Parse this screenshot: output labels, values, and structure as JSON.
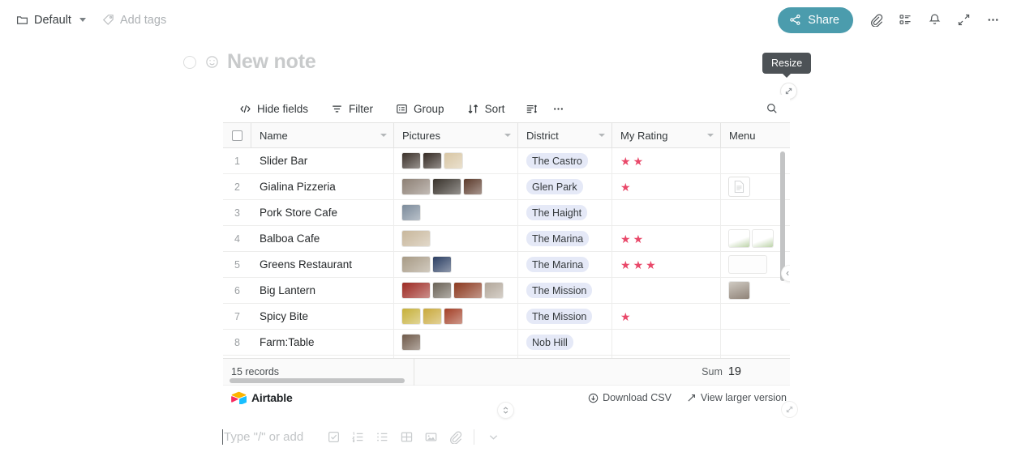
{
  "topbar": {
    "notebook_label": "Default",
    "notebook_icon": "folder-icon",
    "tags_label": "Add tags",
    "tags_icon": "tag-icon",
    "share_label": "Share",
    "share_icon": "share-nodes-icon",
    "share_color": "#4b9cad",
    "icons": [
      {
        "name": "attachment-icon"
      },
      {
        "name": "list-details-icon"
      },
      {
        "name": "bell-icon"
      },
      {
        "name": "expand-icon"
      },
      {
        "name": "more-horizontal-icon"
      }
    ]
  },
  "note": {
    "title": "New note",
    "status_icon": "circle-icon",
    "emoji_icon": "smiley-icon"
  },
  "tooltip": {
    "text": "Resize"
  },
  "embed": {
    "toolbar": [
      {
        "label": "Hide fields",
        "icon": "hide-fields-icon"
      },
      {
        "label": "Filter",
        "icon": "filter-icon"
      },
      {
        "label": "Group",
        "icon": "group-icon"
      },
      {
        "label": "Sort",
        "icon": "sort-icon"
      },
      {
        "label": "",
        "icon": "row-height-icon"
      },
      {
        "label": "",
        "icon": "more-horizontal-icon"
      }
    ],
    "search_icon": "search-icon",
    "columns": [
      {
        "key": "name",
        "label": "Name"
      },
      {
        "key": "pictures",
        "label": "Pictures"
      },
      {
        "key": "district",
        "label": "District"
      },
      {
        "key": "rating",
        "label": "My Rating"
      },
      {
        "key": "menu",
        "label": "Menu"
      }
    ],
    "rows": [
      {
        "num": "1",
        "name": "Slider Bar",
        "district": "The Castro",
        "rating": 2,
        "pictures": [
          "#3c322b",
          "#352b24",
          "#d8c6a4"
        ],
        "pictures_wide": [
          false,
          false,
          false
        ],
        "menu": []
      },
      {
        "num": "2",
        "name": "Gialina Pizzeria",
        "district": "Glen Park",
        "rating": 1,
        "pictures": [
          "#8d8075",
          "#39332c",
          "#5c3b2c"
        ],
        "pictures_wide": [
          true,
          true,
          false
        ],
        "menu": [
          "doc"
        ]
      },
      {
        "num": "3",
        "name": "Pork Store Cafe",
        "district": "The Haight",
        "rating": 0,
        "pictures": [
          "#7c8b9b"
        ],
        "pictures_wide": [
          false
        ],
        "menu": []
      },
      {
        "num": "4",
        "name": "Balboa Cafe",
        "district": "The Marina",
        "rating": 2,
        "pictures": [
          "#c8b79c"
        ],
        "pictures_wide": [
          true
        ],
        "menu": [
          "doc-photo",
          "doc-photo2"
        ]
      },
      {
        "num": "5",
        "name": "Greens Restaurant",
        "district": "The Marina",
        "rating": 3,
        "pictures": [
          "#a89b86",
          "#2c3f63"
        ],
        "pictures_wide": [
          true,
          false
        ],
        "menu": [
          "doc-text"
        ]
      },
      {
        "num": "6",
        "name": "Big Lantern",
        "district": "The Mission",
        "rating": 0,
        "pictures": [
          "#9d2b24",
          "#6b6357",
          "#8c3a20",
          "#b2a79a"
        ],
        "pictures_wide": [
          true,
          false,
          true,
          false
        ],
        "menu": [
          "photo"
        ]
      },
      {
        "num": "7",
        "name": "Spicy Bite",
        "district": "The Mission",
        "rating": 1,
        "pictures": [
          "#c6b03a",
          "#c9a93c",
          "#a33f26"
        ],
        "pictures_wide": [
          false,
          false,
          false
        ],
        "menu": []
      },
      {
        "num": "8",
        "name": "Farm:Table",
        "district": "Nob Hill",
        "rating": 0,
        "pictures": [
          "#6f5a4a"
        ],
        "pictures_wide": [
          false
        ],
        "menu": []
      }
    ],
    "footer": {
      "records_label": "15 records",
      "sum_label": "Sum",
      "sum_value": "19"
    },
    "brand": {
      "name": "Airtable",
      "download_label": "Download CSV",
      "download_icon": "download-icon",
      "larger_label": "View larger version",
      "larger_icon": "expand-diagonal-icon"
    },
    "pill_color": "#e5e9f7",
    "star_color": "#e9496a"
  },
  "editor": {
    "placeholder": "Type \"/\" or add",
    "icons": [
      {
        "name": "checklist-icon"
      },
      {
        "name": "numbered-list-icon"
      },
      {
        "name": "bulleted-list-icon"
      },
      {
        "name": "table-icon"
      },
      {
        "name": "image-icon"
      },
      {
        "name": "attachment-icon"
      },
      {
        "name": "chevron-down-icon"
      }
    ]
  }
}
